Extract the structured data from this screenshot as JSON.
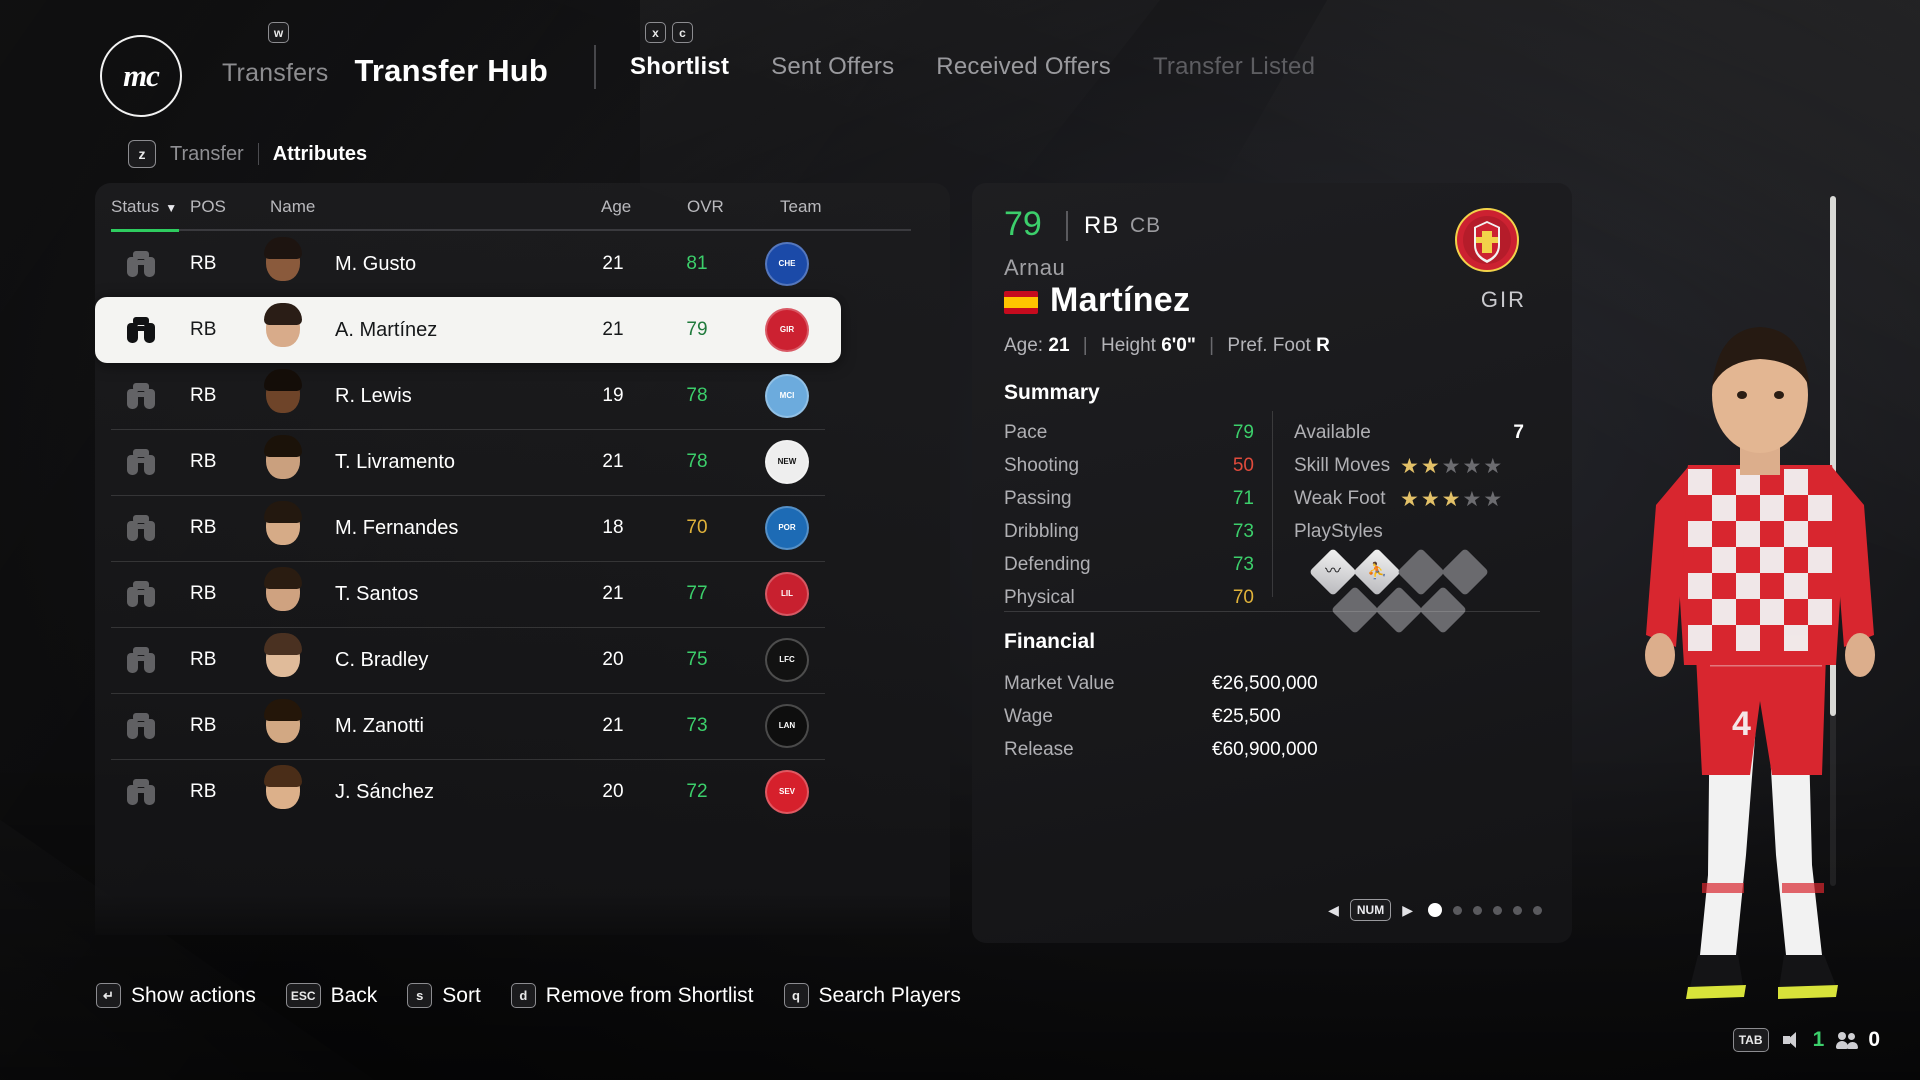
{
  "header": {
    "logo_mark": "mc",
    "breadcrumb_parent": "Transfers",
    "breadcrumb_parent_key": "w",
    "title": "Transfer Hub",
    "tab_keys": [
      "x",
      "c"
    ],
    "tabs": [
      {
        "label": "Shortlist",
        "state": "active"
      },
      {
        "label": "Sent Offers",
        "state": "normal"
      },
      {
        "label": "Received Offers",
        "state": "normal"
      },
      {
        "label": "Transfer Listed",
        "state": "disabled"
      }
    ]
  },
  "subtabs": {
    "key": "z",
    "items": [
      {
        "label": "Transfer",
        "state": "normal"
      },
      {
        "label": "Attributes",
        "state": "active"
      }
    ]
  },
  "table": {
    "columns": [
      "Status",
      "POS",
      "Name",
      "Age",
      "OVR",
      "Team"
    ],
    "sorted_by": "Status",
    "sort_direction": "desc",
    "sort_caret": "▼",
    "rows": [
      {
        "status_icon": "binoculars-icon",
        "pos": "RB",
        "name": "M. Gusto",
        "age": "21",
        "ovr": "81",
        "ovr_color": "green",
        "team": "Chelsea",
        "team_abbr": "CHE",
        "crest_bg": "#1b4aa8",
        "crest_fg": "#ffffff",
        "selected": false,
        "skin": "#8a5a3c",
        "hair": "#1d1410",
        "kit": "#1b3a8a"
      },
      {
        "status_icon": "binoculars-icon",
        "pos": "RB",
        "name": "A. Martínez",
        "age": "21",
        "ovr": "79",
        "ovr_color": "green",
        "team": "Girona",
        "team_abbr": "GIR",
        "crest_bg": "#cc2131",
        "crest_fg": "#ffffff",
        "selected": true,
        "skin": "#d8ab8a",
        "hair": "#2a1d16",
        "kit": "#2a4c9c"
      },
      {
        "status_icon": "binoculars-icon",
        "pos": "RB",
        "name": "R. Lewis",
        "age": "19",
        "ovr": "78",
        "ovr_color": "green",
        "team": "Manchester City",
        "team_abbr": "MCI",
        "crest_bg": "#6cabdd",
        "crest_fg": "#ffffff",
        "selected": false,
        "skin": "#6e4429",
        "hair": "#140d08",
        "kit": "#6cabdd"
      },
      {
        "status_icon": "binoculars-icon",
        "pos": "RB",
        "name": "T. Livramento",
        "age": "21",
        "ovr": "78",
        "ovr_color": "green",
        "team": "Newcastle United",
        "team_abbr": "NEW",
        "crest_bg": "#eeeeee",
        "crest_fg": "#111111",
        "selected": false,
        "skin": "#caa07e",
        "hair": "#1b1209",
        "kit": "#e8e8e8"
      },
      {
        "status_icon": "binoculars-icon",
        "pos": "RB",
        "name": "M. Fernandes",
        "age": "18",
        "ovr": "70",
        "ovr_color": "yellow",
        "team": "FC Porto",
        "team_abbr": "POR",
        "crest_bg": "#1d6bb5",
        "crest_fg": "#ffffff",
        "selected": false,
        "skin": "#d6ab87",
        "hair": "#23180f",
        "kit": "#3f6cc0"
      },
      {
        "status_icon": "binoculars-icon",
        "pos": "RB",
        "name": "T. Santos",
        "age": "21",
        "ovr": "77",
        "ovr_color": "green",
        "team": "LOSC Lille",
        "team_abbr": "LIL",
        "crest_bg": "#c8202f",
        "crest_fg": "#ffffff",
        "selected": false,
        "skin": "#cfa280",
        "hair": "#2a1c11",
        "kit": "#c8202f"
      },
      {
        "status_icon": "binoculars-icon",
        "pos": "RB",
        "name": "C. Bradley",
        "age": "20",
        "ovr": "75",
        "ovr_color": "green",
        "team": "Liverpool",
        "team_abbr": "LFC",
        "crest_bg": "#121212",
        "crest_fg": "#ffffff",
        "selected": false,
        "skin": "#e0bb9a",
        "hair": "#4a3121",
        "kit": "#2f2f33"
      },
      {
        "status_icon": "binoculars-icon",
        "pos": "RB",
        "name": "M. Zanotti",
        "age": "21",
        "ovr": "73",
        "ovr_color": "green",
        "team": "Lanús",
        "team_abbr": "LAN",
        "crest_bg": "#0e0e0e",
        "crest_fg": "#ffffff",
        "selected": false,
        "skin": "#d2a883",
        "hair": "#241609",
        "kit": "#2b2b2f"
      },
      {
        "status_icon": "binoculars-icon",
        "pos": "RB",
        "name": "J. Sánchez",
        "age": "20",
        "ovr": "72",
        "ovr_color": "green",
        "team": "Sevilla",
        "team_abbr": "SEV",
        "crest_bg": "#d6202c",
        "crest_fg": "#ffffff",
        "selected": false,
        "skin": "#dcb08a",
        "hair": "#4a2d18",
        "kit": "#1a6b3c"
      }
    ]
  },
  "detail": {
    "ovr": "79",
    "position_primary": "RB",
    "position_secondary": "CB",
    "first_name": "Arnau",
    "last_name": "Martínez",
    "nationality": "Spain",
    "club_abbr": "GIR",
    "club": "Girona",
    "bio_age_label": "Age:",
    "bio_age": "21",
    "bio_height_label": "Height",
    "bio_height": "6'0\"",
    "bio_foot_label": "Pref. Foot",
    "bio_foot": "R",
    "summary_title": "Summary",
    "summary_stats": [
      {
        "label": "Pace",
        "value": "79",
        "color": "green"
      },
      {
        "label": "Shooting",
        "value": "50",
        "color": "red"
      },
      {
        "label": "Passing",
        "value": "71",
        "color": "green"
      },
      {
        "label": "Dribbling",
        "value": "73",
        "color": "green"
      },
      {
        "label": "Defending",
        "value": "73",
        "color": "green"
      },
      {
        "label": "Physical",
        "value": "70",
        "color": "yellow"
      }
    ],
    "available_label": "Available",
    "available_value": "7",
    "skill_moves_label": "Skill Moves",
    "skill_moves": 2,
    "weak_foot_label": "Weak Foot",
    "weak_foot": 3,
    "star_max": 5,
    "playstyles_label": "PlayStyles",
    "playstyles": [
      {
        "filled": true,
        "glyph": "〰"
      },
      {
        "filled": true,
        "glyph": "⛹"
      },
      {
        "filled": false,
        "glyph": ""
      },
      {
        "filled": false,
        "glyph": ""
      },
      {
        "filled": false,
        "glyph": ""
      },
      {
        "filled": false,
        "glyph": ""
      },
      {
        "filled": false,
        "glyph": ""
      }
    ],
    "financial_title": "Financial",
    "financial": [
      {
        "label": "Market Value",
        "value": "€26,500,000"
      },
      {
        "label": "Wage",
        "value": "€25,500"
      },
      {
        "label": "Release",
        "value": "€60,900,000"
      }
    ],
    "pager": {
      "left_arrow": "◀",
      "right_arrow": "▶",
      "key": "NUM",
      "page_count": 6,
      "active_page": 1
    }
  },
  "hints": [
    {
      "key": "↵",
      "label": "Show actions"
    },
    {
      "key": "ESC",
      "label": "Back"
    },
    {
      "key": "s",
      "label": "Sort"
    },
    {
      "key": "d",
      "label": "Remove from Shortlist"
    },
    {
      "key": "q",
      "label": "Search Players"
    }
  ],
  "hud": {
    "tab_key": "TAB",
    "messages_count": "1",
    "squad_count": "0"
  }
}
